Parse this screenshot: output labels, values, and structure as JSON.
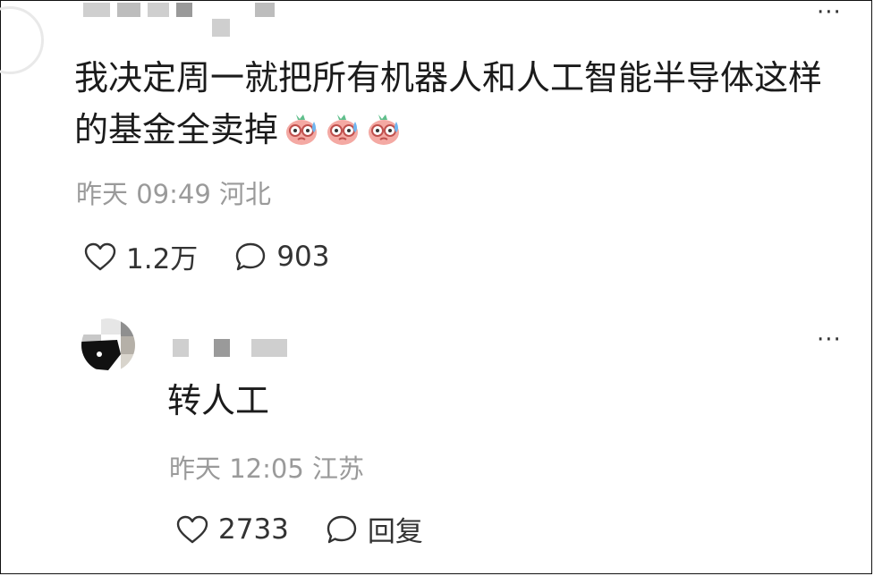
{
  "comment": {
    "username_masked": "",
    "text": "我决定周一就把所有机器人和人工智能半导体这样的基金全卖掉",
    "emojis": [
      "sweating-face-emoji",
      "sweating-face-emoji",
      "sweating-face-emoji"
    ],
    "timestamp": "昨天 09:49",
    "location": "河北",
    "like_count": "1.2万",
    "reply_count": "903",
    "more_icon": "more-dots-icon"
  },
  "reply": {
    "username_masked": "",
    "text": "转人工",
    "timestamp": "昨天 12:05",
    "location": "江苏",
    "like_count": "2733",
    "reply_label": "回复",
    "more_icon": "more-dots-icon"
  }
}
